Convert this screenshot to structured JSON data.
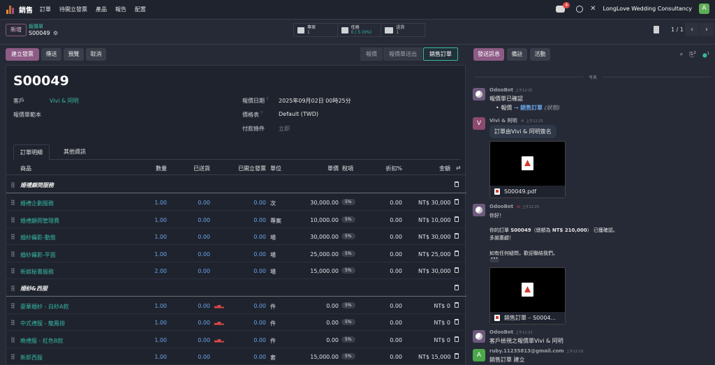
{
  "topbar": {
    "app_name": "銷售",
    "menu": [
      "訂單",
      "待開立發票",
      "產品",
      "報告",
      "配置"
    ],
    "chat_badge": "4",
    "company": "LongLove Wedding Consultancy",
    "avatar_letter": "A"
  },
  "control": {
    "new_label": "新增",
    "breadcrumb_parent": "報價單",
    "breadcrumb_current": "S00049",
    "smart_buttons": [
      {
        "title": "專案",
        "value": "1",
        "icon": "puzzle-icon"
      },
      {
        "title": "任務",
        "value": "0 / 5 (0%)",
        "icon": "check-icon"
      },
      {
        "title": "送貨",
        "value": "1",
        "icon": "truck-icon"
      }
    ],
    "pager": "1 / 1",
    "prev": "‹",
    "next": "›"
  },
  "statusbar": {
    "buttons": [
      "建立發票",
      "傳送",
      "預覽",
      "取消"
    ],
    "stages": [
      "報價",
      "報價單送出",
      "銷售訂單"
    ],
    "active_stage": "銷售訂單"
  },
  "form": {
    "title": "S00049",
    "customer_label": "客戶",
    "customer_value": "Vivi & 阿明",
    "template_label": "報價單範本",
    "date_label": "報價日期",
    "date_value": "2025年09月02日 00時25分",
    "pricelist_label": "價格表",
    "pricelist_value": "Default (TWD)",
    "payment_label": "付款條件",
    "payment_placeholder": "立即",
    "help_mark": "?",
    "tabs": [
      "訂單明細",
      "其他資訊"
    ]
  },
  "table": {
    "headers": {
      "product": "商品",
      "qty": "數量",
      "delivered": "已送貨",
      "invoiced": "已開立發票",
      "unit": "單位",
      "price": "單價",
      "tax": "稅項",
      "discount": "折扣%",
      "amount": "金額"
    },
    "sections": [
      "婚禮顧問服務",
      "婚紗&西服"
    ],
    "rows": [
      {
        "product": "婚禮企劃服務",
        "qty": "1.00",
        "delivered": "0.00",
        "invoiced": "0.00",
        "unit": "次",
        "price": "30,000.00",
        "tax": "5%",
        "discount": "0.00",
        "amount": "NT$ 30,000"
      },
      {
        "product": "婚禮顧問管理費",
        "qty": "1.00",
        "delivered": "0.00",
        "invoiced": "0.00",
        "unit": "專案",
        "price": "10,000.00",
        "tax": "5%",
        "discount": "0.00",
        "amount": "NT$ 10,000"
      },
      {
        "product": "婚紗攝影-動態",
        "qty": "1.00",
        "delivered": "0.00",
        "invoiced": "0.00",
        "unit": "場",
        "price": "30,000.00",
        "tax": "5%",
        "discount": "0.00",
        "amount": "NT$ 30,000"
      },
      {
        "product": "婚紗攝影-平面",
        "qty": "1.00",
        "delivered": "0.00",
        "invoiced": "0.00",
        "unit": "場",
        "price": "25,000.00",
        "tax": "5%",
        "discount": "0.00",
        "amount": "NT$ 25,000"
      },
      {
        "product": "新娘秘書服務",
        "qty": "2.00",
        "delivered": "0.00",
        "invoiced": "0.00",
        "unit": "場",
        "price": "15,000.00",
        "tax": "5%",
        "discount": "0.00",
        "amount": "NT$ 30,000"
      },
      {
        "product": "豪華婚紗 - 白紗A款",
        "qty": "1.00",
        "delivered": "0.00",
        "invoiced": "0.00",
        "unit": "件",
        "price": "0.00",
        "tax": "5%",
        "discount": "0.00",
        "amount": "NT$ 0"
      },
      {
        "product": "中式禮服 - 龍鳳褂",
        "qty": "1.00",
        "delivered": "0.00",
        "invoiced": "0.00",
        "unit": "件",
        "price": "0.00",
        "tax": "5%",
        "discount": "0.00",
        "amount": "NT$ 0"
      },
      {
        "product": "晚禮服 - 紅色B款",
        "qty": "1.00",
        "delivered": "0.00",
        "invoiced": "0.00",
        "unit": "件",
        "price": "0.00",
        "tax": "5%",
        "discount": "0.00",
        "amount": "NT$ 0"
      },
      {
        "product": "新郎西服",
        "qty": "1.00",
        "delivered": "0.00",
        "invoiced": "0.00",
        "unit": "套",
        "price": "15,000.00",
        "tax": "5%",
        "discount": "0.00",
        "amount": "NT$ 15,000"
      }
    ]
  },
  "chatter": {
    "buttons": [
      "發送訊息",
      "備註",
      "活動"
    ],
    "attach_count": "2",
    "follower_count": "1",
    "today": "今天",
    "messages": [
      {
        "author": "OdooBot",
        "time": "上午12:25",
        "line1": "報價單已確認",
        "bullet_prefix": "報價",
        "bullet_arrow": "→",
        "bullet_value": "銷售訂單",
        "bullet_note": "(狀態)"
      },
      {
        "author": "Vivi & 阿明",
        "time": "上午12:25",
        "bubble": "訂單由Vivi & 阿明簽名",
        "attachment": "S00049.pdf",
        "avatar": "V"
      },
      {
        "author": "OdooBot",
        "time": "上午12:25",
        "greeting": "你好！",
        "body1_pre": "你的訂單 ",
        "body1_order": "S00049",
        "body1_mid": "（總額為 ",
        "body1_total": "NT$ 210,000",
        "body1_post": "） 已獲確認。",
        "body2": "多謝惠顧！",
        "body3": "如有任何疑問，歡迎聯絡我們。",
        "dots": "•••",
        "attachment": "銷售訂單 – S0004..."
      },
      {
        "author": "OdooBot",
        "time": "上午12:23",
        "text": "客戶檢視之報價單Vivi & 阿明"
      },
      {
        "author": "ruby.11235813@gmail.com",
        "time": "上午12:19",
        "text": "銷售訂單 建立",
        "avatar": "A"
      }
    ]
  }
}
